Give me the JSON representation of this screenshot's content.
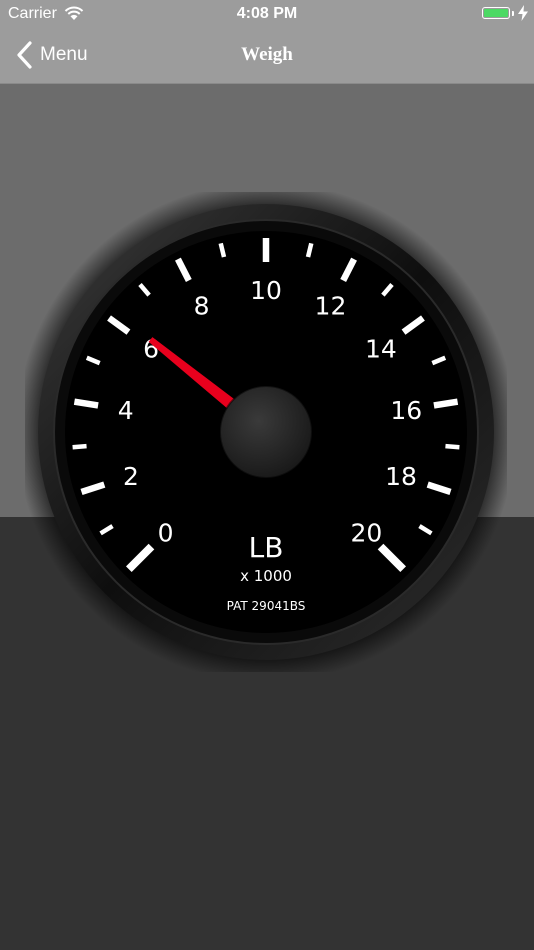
{
  "status_bar": {
    "carrier": "Carrier",
    "time": "4:08 PM",
    "battery_level": 1.0,
    "battery_color": "#4cd964",
    "icons": [
      "wifi-icon",
      "battery-icon",
      "charging-bolt-icon"
    ]
  },
  "nav": {
    "back_label": "Menu",
    "back_icon": "chevron-left-icon",
    "title": "Weigh"
  },
  "gauge": {
    "unit": "LB",
    "multiplier": "x 1000",
    "patent": "PAT 29041BS",
    "min": 0,
    "max": 20,
    "major_step": 2,
    "labels": [
      "0",
      "2",
      "4",
      "6",
      "8",
      "10",
      "12",
      "14",
      "16",
      "18",
      "20"
    ],
    "needle_value": 6.2,
    "needle_color": "#e8001d",
    "face_color": "#000000",
    "tick_color": "#ffffff"
  },
  "colors": {
    "bars": "#9c9c9c",
    "upper_background": "#6c6c6c",
    "lower_background": "#333333"
  }
}
